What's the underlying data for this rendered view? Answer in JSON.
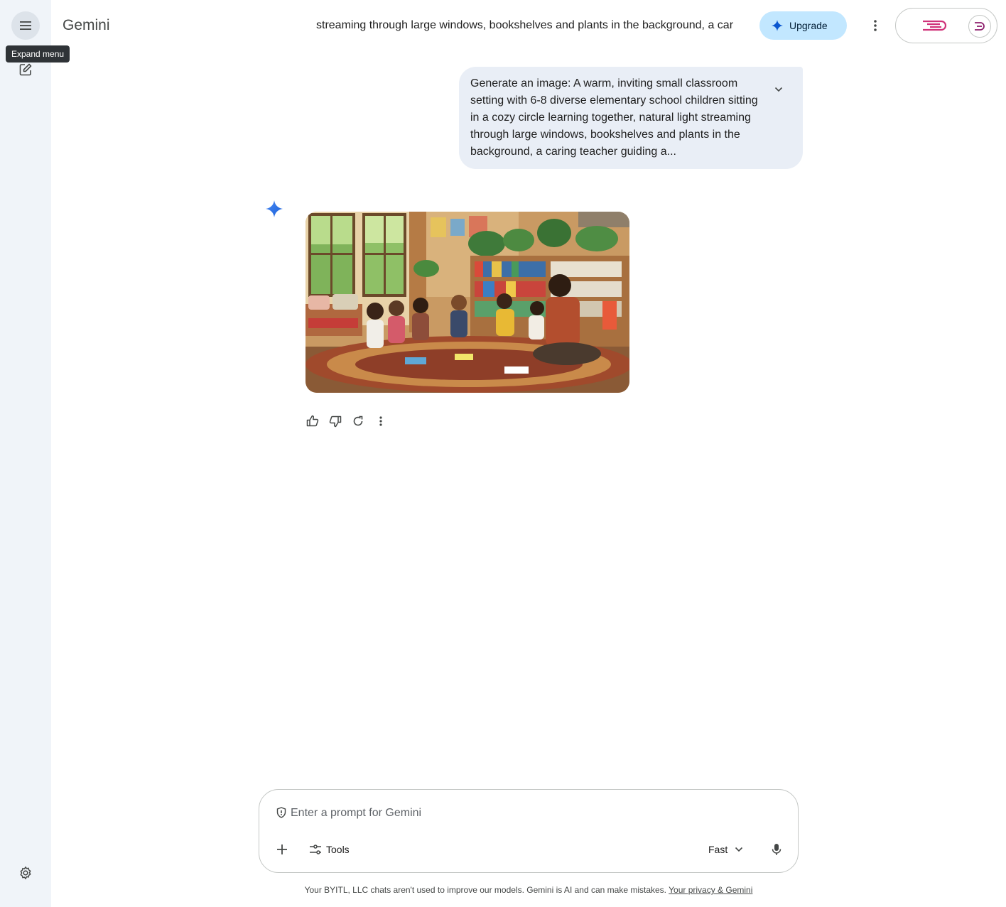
{
  "app": {
    "title": "Gemini"
  },
  "sidebar": {
    "menu_icon": "menu-icon",
    "tooltip": "Expand menu",
    "new_chat_icon": "edit-square-icon",
    "settings_icon": "gear-icon"
  },
  "header": {
    "chat_title": "streaming through large windows, bookshelves and plants in the background, a car",
    "upgrade_label": "Upgrade",
    "upgrade_icon": "spark-icon",
    "more_icon": "more-vert-icon",
    "account_logo": "brand-logo",
    "accent_color": "#c2e7ff"
  },
  "conversation": {
    "user_message": "Generate an image: A warm, inviting small classroom setting with 6-8 diverse elementary school children sitting in a cozy circle learning together, natural light streaming through large windows, bookshelves and plants in the background, a caring teacher guiding a...",
    "expand_icon": "chevron-down-icon",
    "response_icon": "gemini-spark-icon",
    "actions": [
      {
        "name": "thumb-up-icon"
      },
      {
        "name": "thumb-down-icon"
      },
      {
        "name": "redo-icon"
      },
      {
        "name": "more-vert-icon"
      }
    ]
  },
  "input": {
    "placeholder": "Enter a prompt for Gemini",
    "value": "",
    "tools_label": "Tools",
    "model_label": "Fast",
    "mic_icon": "mic-icon"
  },
  "footer": {
    "disclaimer": "Your BYITL, LLC chats aren't used to improve our models. Gemini is AI and can make mistakes.",
    "privacy_link": "Your privacy & Gemini"
  }
}
